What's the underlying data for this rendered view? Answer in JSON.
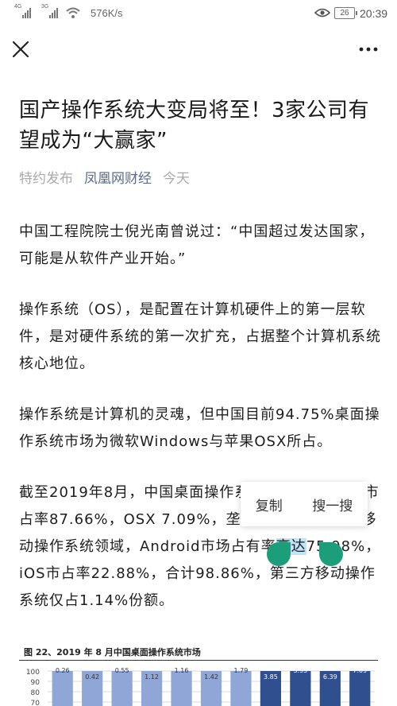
{
  "status_bar": {
    "net_label_1": "4G",
    "net_label_2": "3G",
    "speed": "576K/s",
    "battery": "26",
    "time": "20:39"
  },
  "nav": {
    "close_icon": "close-icon",
    "more_icon": "more-icon"
  },
  "article": {
    "title": "国产操作系统大变局将至！3家公司有望成为“大赢家”",
    "meta": {
      "tag": "特约发布",
      "source": "凤凰网财经",
      "time": "今天"
    },
    "paragraphs": [
      "中国工程院院士倪光南曾说过：“中国超过发达国家，可能是从软件产业开始。”",
      "操作系统（OS），是配置在计算机硬件上的第一层软件，是对硬件系统的第一次扩充，占据整个计算机系统核心地位。",
      "操作系统是计算机的灵魂，但中国目前94.75%桌面操作系统市场为微软Windows与苹果OSX所占。"
    ],
    "p4": {
      "before": "截至2019年8月，中国桌面操作系统市场Windows市占率87.66%，OSX 7.09%，垄断整个桌面市场；移动操作系统领域，Android市场占有率",
      "selected": "高达",
      "after": "75.98%，iOS市占率22.88%，合计98.86%，第三方移动操作系统仅占1.14%份额。"
    }
  },
  "popup": {
    "copy": "复制",
    "search": "搜一搜"
  },
  "figure": {
    "title": "图 22、2019 年 8 月中国桌面操作系统市场"
  },
  "chart_data": {
    "type": "bar",
    "title": "图 22、2019 年 8 月中国桌面操作系统市场",
    "ylim": [
      70,
      100
    ],
    "yticks": [
      "100",
      "90",
      "80",
      "70"
    ],
    "series": [
      {
        "values": [
          0.26,
          0.42,
          0.55,
          1.12,
          1.16,
          1.42,
          1.79,
          3.85,
          3.95,
          6.39,
          7.09
        ],
        "color": "#8fa6d6"
      }
    ],
    "highlight_color": "#2f4f8f",
    "grid": true
  }
}
